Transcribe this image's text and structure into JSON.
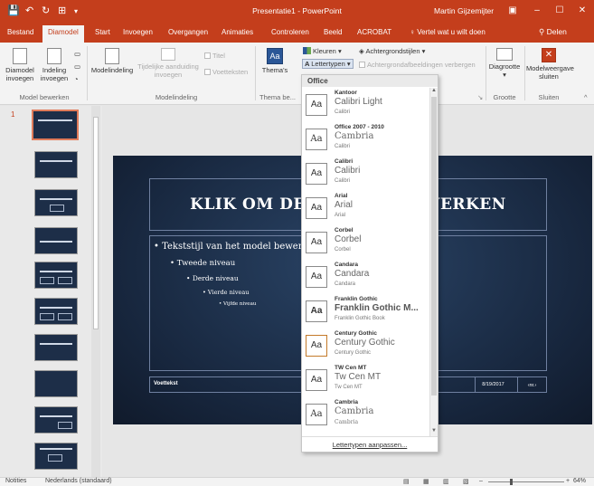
{
  "titlebar": {
    "title": "Presentatie1 - PowerPoint",
    "user": "Martin Gijzemijter",
    "save_icon": "💾",
    "undo_icon": "↶",
    "redo_icon": "↻",
    "start_icon": "⊞",
    "customize_icon": "▾",
    "ribbon_opts_icon": "▣",
    "minimize_icon": "–",
    "maximize_icon": "☐",
    "close_icon": "✕"
  },
  "tabs": {
    "items": [
      {
        "label": "Bestand"
      },
      {
        "label": "Diamodel"
      },
      {
        "label": "Start"
      },
      {
        "label": "Invoegen"
      },
      {
        "label": "Overgangen"
      },
      {
        "label": "Animaties"
      },
      {
        "label": "Controleren"
      },
      {
        "label": "Beeld"
      },
      {
        "label": "ACROBAT"
      }
    ],
    "tell_me": "Vertel wat u wilt doen",
    "share": "Delen"
  },
  "ribbon": {
    "btn_insert_slide_master": "Diamodel invoegen",
    "btn_insert_layout": "Indeling invoegen",
    "group_edit_master": "Model bewerken",
    "btn_master_layout": "Modelindeling",
    "btn_placeholder": "Tijdelijke aanduiding invoegen",
    "chk_title": "Titel",
    "chk_footers": "Voetteksten",
    "group_master_layout": "Modelindeling",
    "btn_themes": "Thema's",
    "group_theme": "Thema be...",
    "btn_colors": "Kleuren",
    "btn_fonts": "Lettertypen",
    "btn_bg_styles": "Achtergrondstijlen",
    "chk_hide_bg": "Achtergrondafbeeldingen verbergen",
    "btn_slide_size": "Diagrootte",
    "group_size": "Grootte",
    "btn_close_master": "Modelweergave sluiten",
    "group_close": "Sluiten"
  },
  "font_dropdown": {
    "header": "Office",
    "items": [
      {
        "name": "Kantoor",
        "heading": "Calibri Light",
        "body": "Calibri"
      },
      {
        "name": "Office 2007 - 2010",
        "heading": "Cambria",
        "body": "Calibri"
      },
      {
        "name": "Calibri",
        "heading": "Calibri",
        "body": "Calibri"
      },
      {
        "name": "Arial",
        "heading": "Arial",
        "body": "Arial"
      },
      {
        "name": "Corbel",
        "heading": "Corbel",
        "body": "Corbel"
      },
      {
        "name": "Candara",
        "heading": "Candara",
        "body": "Candara"
      },
      {
        "name": "Franklin Gothic",
        "heading": "Franklin Gothic M...",
        "body": "Franklin Gothic Book"
      },
      {
        "name": "Century Gothic",
        "heading": "Century Gothic",
        "body": "Century Gothic"
      },
      {
        "name": "TW Cen MT",
        "heading": "Tw Cen MT",
        "body": "Tw Cen MT"
      },
      {
        "name": "Cambria",
        "heading": "Cambria",
        "body": "Cambria"
      }
    ],
    "sample": "Aa",
    "footer": "Lettertypen aanpassen..."
  },
  "slide": {
    "number": "1",
    "title": "KLIK OM DE STIJL TE BEWERKEN",
    "bullets": [
      "Tekststijl van het model bewerken",
      "Tweede niveau",
      "Derde niveau",
      "Vierde niveau",
      "Vijfde niveau"
    ],
    "footer": "Voettekst",
    "date": "8/19/2017",
    "page_num": "‹nr.›"
  },
  "status": {
    "view": "Notities",
    "language": "Nederlands (standaard)",
    "zoom": "64%"
  },
  "colors": {
    "accent": "#c43e1c",
    "slide_bg": "#1d2e48"
  }
}
